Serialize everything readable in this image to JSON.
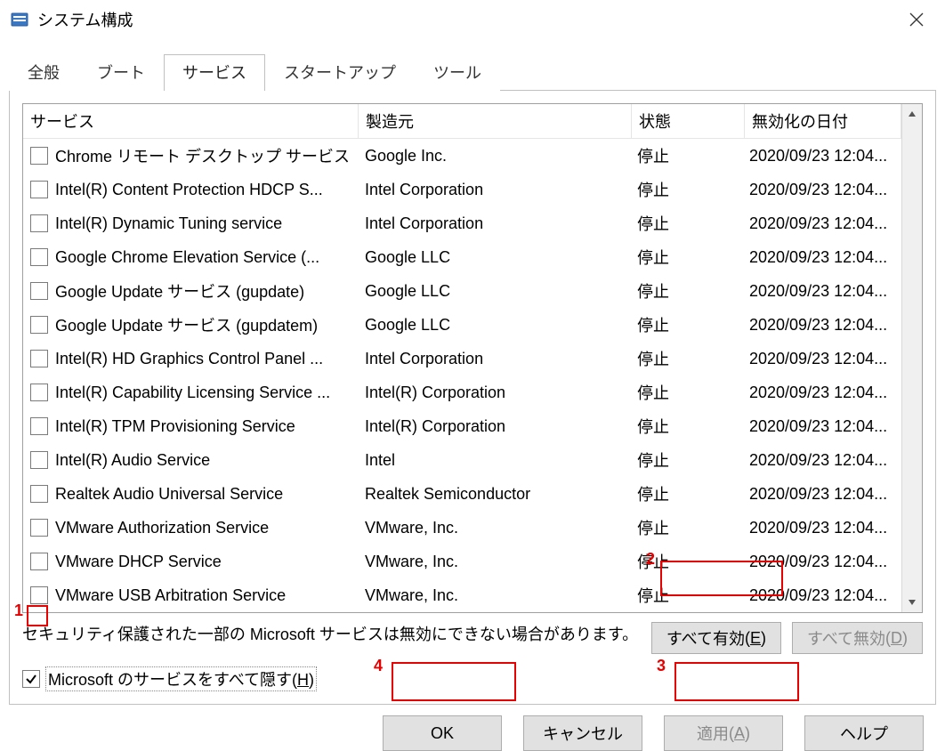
{
  "window": {
    "title": "システム構成"
  },
  "tabs": {
    "general": "全般",
    "boot": "ブート",
    "services": "サービス",
    "startup": "スタートアップ",
    "tools": "ツール",
    "active": "services"
  },
  "columns": {
    "service": "サービス",
    "mfr": "製造元",
    "state": "状態",
    "date": "無効化の日付"
  },
  "rows": [
    {
      "service": "Chrome リモート デスクトップ サービス",
      "mfr": "Google Inc.",
      "state": "停止",
      "date": "2020/09/23 12:04..."
    },
    {
      "service": "Intel(R) Content Protection HDCP S...",
      "mfr": "Intel Corporation",
      "state": "停止",
      "date": "2020/09/23 12:04..."
    },
    {
      "service": "Intel(R) Dynamic Tuning service",
      "mfr": "Intel Corporation",
      "state": "停止",
      "date": "2020/09/23 12:04..."
    },
    {
      "service": "Google Chrome Elevation Service (...",
      "mfr": "Google LLC",
      "state": "停止",
      "date": "2020/09/23 12:04..."
    },
    {
      "service": "Google Update サービス (gupdate)",
      "mfr": "Google LLC",
      "state": "停止",
      "date": "2020/09/23 12:04..."
    },
    {
      "service": "Google Update サービス (gupdatem)",
      "mfr": "Google LLC",
      "state": "停止",
      "date": "2020/09/23 12:04..."
    },
    {
      "service": "Intel(R) HD Graphics Control Panel ...",
      "mfr": "Intel Corporation",
      "state": "停止",
      "date": "2020/09/23 12:04..."
    },
    {
      "service": "Intel(R) Capability Licensing Service ...",
      "mfr": "Intel(R) Corporation",
      "state": "停止",
      "date": "2020/09/23 12:04..."
    },
    {
      "service": "Intel(R) TPM Provisioning Service",
      "mfr": "Intel(R) Corporation",
      "state": "停止",
      "date": "2020/09/23 12:04..."
    },
    {
      "service": "Intel(R) Audio Service",
      "mfr": "Intel",
      "state": "停止",
      "date": "2020/09/23 12:04..."
    },
    {
      "service": "Realtek Audio Universal Service",
      "mfr": "Realtek Semiconductor",
      "state": "停止",
      "date": "2020/09/23 12:04..."
    },
    {
      "service": "VMware Authorization Service",
      "mfr": "VMware, Inc.",
      "state": "停止",
      "date": "2020/09/23 12:04..."
    },
    {
      "service": "VMware DHCP Service",
      "mfr": "VMware, Inc.",
      "state": "停止",
      "date": "2020/09/23 12:04..."
    },
    {
      "service": "VMware USB Arbitration Service",
      "mfr": "VMware, Inc.",
      "state": "停止",
      "date": "2020/09/23 12:04..."
    }
  ],
  "notes": {
    "security": "セキュリティ保護された一部の Microsoft サービスは無効にできない場合があります。"
  },
  "buttons": {
    "enable_all": {
      "label": "すべて有効",
      "accel": "E"
    },
    "disable_all": {
      "label": "すべて無効",
      "accel": "D"
    },
    "ok": "OK",
    "cancel": "キャンセル",
    "apply": {
      "label": "適用",
      "accel": "A"
    },
    "help": "ヘルプ"
  },
  "hide_ms": {
    "label": "Microsoft のサービスをすべて隠す",
    "accel": "H",
    "checked": true
  },
  "annotations": {
    "n1": "1",
    "n2": "2",
    "n3": "3",
    "n4": "4"
  }
}
